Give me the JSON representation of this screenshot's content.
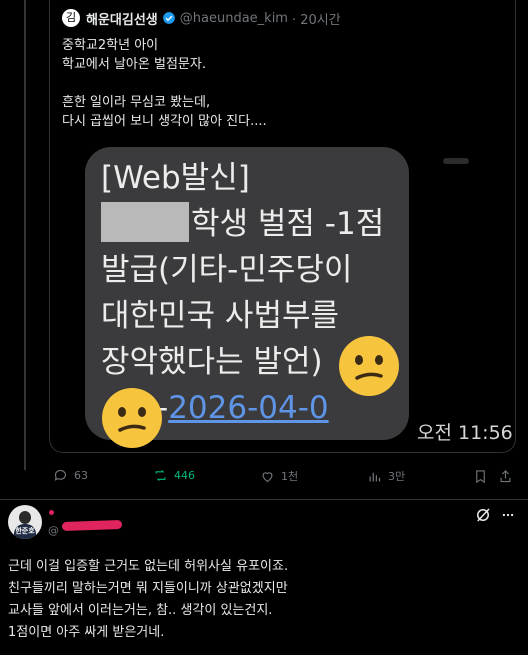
{
  "quoted_post": {
    "avatar_text": "김",
    "author_name": "해운대김선생",
    "handle": "@haeundae_kim",
    "time": "· 20시간",
    "body": "중학교2학년 아이\n학교에서 날아온 벌점문자.\n\n흔한 일이라 무심코 봤는데,\n다시 곱씹어 보니 생각이 많아 진다....",
    "sms": {
      "line1": "[Web발신]",
      "line2_after_redaction": "학생 벌점 -1점",
      "line3": "발급(기타-민주당이",
      "line4": "대한민국 사법부를",
      "line5": "장악했다는 발언)",
      "date_prefix": "-",
      "date_link": "2026-04-0",
      "time": "오전 11:56"
    }
  },
  "actions": {
    "replies": "63",
    "reposts": "446",
    "likes": "1천",
    "views": "3만"
  },
  "reply": {
    "avatar_badge": "한준호",
    "handle_visible": "@",
    "body": "근데 이걸 입증할 근거도 없는데 허위사실 유포이죠.\n친구들끼리 말하는거면 뭐 지들이니까 상관없겠지만\n교사들 앞에서 이러는거는, 참.. 생각이 있는건지.\n1점이면 아주 싸게 받은거네."
  },
  "colors": {
    "background": "#000000",
    "text": "#e7e9ea",
    "muted": "#71767b",
    "repost_green": "#00ba7c",
    "link_blue": "#5e95e6",
    "verified_blue": "#1d9bf0"
  },
  "icons": [
    "verified-badge-icon",
    "reply-icon",
    "repost-icon",
    "like-icon",
    "views-icon",
    "bookmark-icon",
    "share-icon",
    "grok-icon",
    "more-icon",
    "confused-face-icon"
  ]
}
